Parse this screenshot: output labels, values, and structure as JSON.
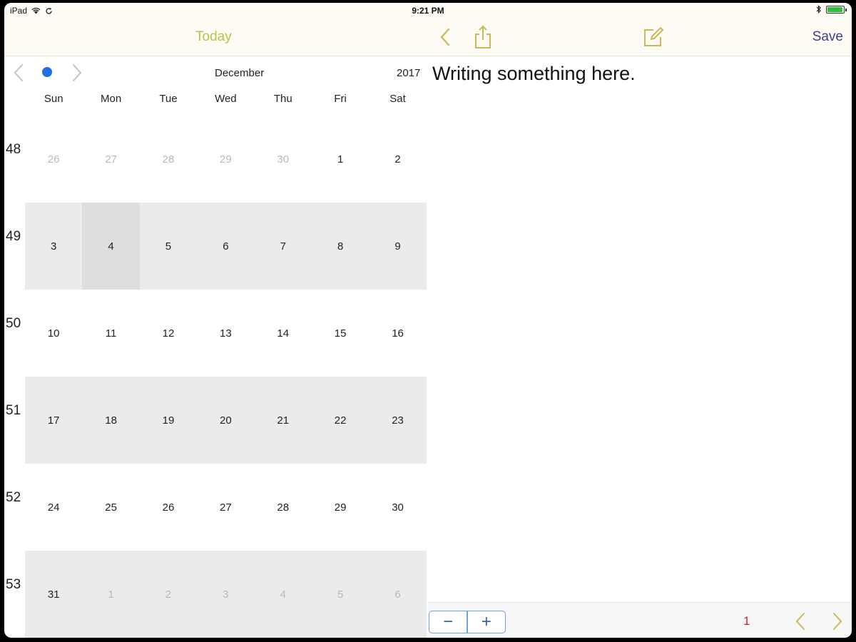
{
  "status_bar": {
    "device": "iPad",
    "time": "9:21 PM",
    "battery_level": 0.95
  },
  "nav": {
    "today_label": "Today",
    "save_label": "Save"
  },
  "calendar": {
    "month": "December",
    "year": "2017",
    "weekdays": [
      "Sun",
      "Mon",
      "Tue",
      "Wed",
      "Thu",
      "Fri",
      "Sat"
    ],
    "weeks": [
      {
        "num": "48",
        "days": [
          "26",
          "27",
          "28",
          "29",
          "30",
          "1",
          "2"
        ]
      },
      {
        "num": "49",
        "days": [
          "3",
          "4",
          "5",
          "6",
          "7",
          "8",
          "9"
        ]
      },
      {
        "num": "50",
        "days": [
          "10",
          "11",
          "12",
          "13",
          "14",
          "15",
          "16"
        ]
      },
      {
        "num": "51",
        "days": [
          "17",
          "18",
          "19",
          "20",
          "21",
          "22",
          "23"
        ]
      },
      {
        "num": "52",
        "days": [
          "24",
          "25",
          "26",
          "27",
          "28",
          "29",
          "30"
        ]
      },
      {
        "num": "53",
        "days": [
          "31",
          "1",
          "2",
          "3",
          "4",
          "5",
          "6"
        ]
      }
    ],
    "selected_day": "4"
  },
  "editor": {
    "text": "Writing something here."
  },
  "footer": {
    "minus_label": "−",
    "plus_label": "+",
    "page_number": "1"
  },
  "colors": {
    "accent_yellow": "#b5c44d",
    "save_blue": "#3b3d9a",
    "dot_blue": "#1f6fe0",
    "page_red": "#c6252d"
  }
}
